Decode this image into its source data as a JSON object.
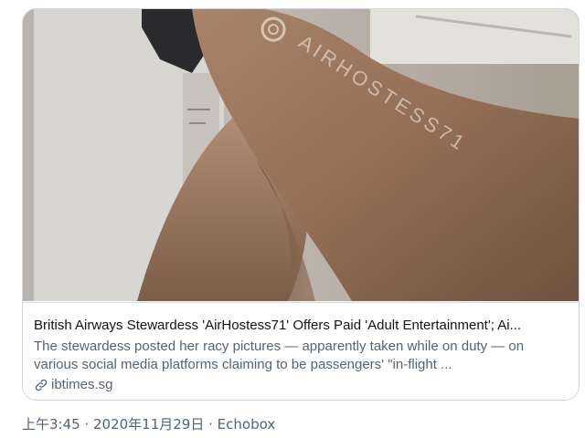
{
  "card": {
    "watermark": "AIRHOSTESS71",
    "title": "British Airways Stewardess 'AirHostess71' Offers Paid 'Adult Entertainment'; Ai...",
    "description": "The stewardess posted her racy pictures — apparently taken while on duty — on various social media platforms claiming to be passengers' \"in-flight ...",
    "domain": "ibtimes.sg",
    "domain_icon": "link-icon"
  },
  "meta": {
    "time": "上午3:45",
    "separator1": " · ",
    "date": "2020年11月29日",
    "separator2": " · ",
    "source": "Echobox"
  }
}
